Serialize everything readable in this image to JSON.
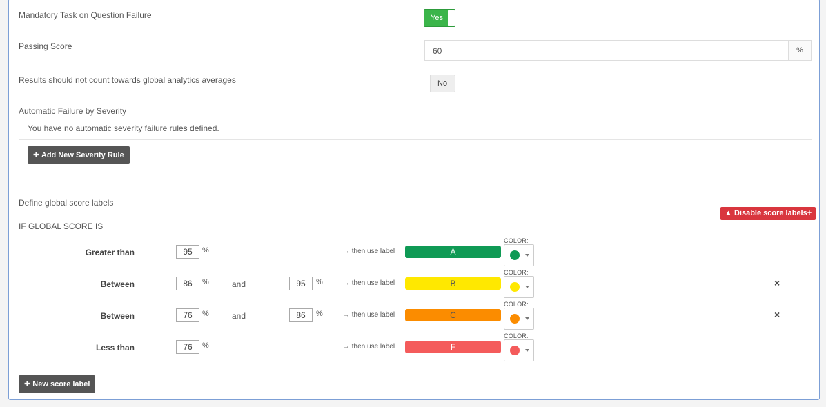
{
  "settings": {
    "mandatory_task": {
      "label": "Mandatory Task on Question Failure",
      "value": "Yes"
    },
    "passing_score": {
      "label": "Passing Score",
      "value": "60",
      "suffix": "%"
    },
    "exclude_analytics": {
      "label": "Results should not count towards global analytics averages",
      "value": "No"
    },
    "severity": {
      "label": "Automatic Failure by Severity",
      "empty_text": "You have no automatic severity failure rules defined.",
      "add_button": "Add New Severity Rule"
    }
  },
  "score_labels": {
    "title": "Define global score labels",
    "condition_heading": "IF GLOBAL SCORE IS",
    "disable_button": "Disable score labels+",
    "then_text": "then use label",
    "color_label": "COLOR:",
    "and_text": "and",
    "pct": "%",
    "rows": [
      {
        "condition": "Greater than",
        "from": "95",
        "to": null,
        "label": "A",
        "color": "#0f9a55",
        "text_color": "#ffffff",
        "removable": false
      },
      {
        "condition": "Between",
        "from": "86",
        "to": "95",
        "label": "B",
        "color": "#ffe800",
        "text_color": "#555555",
        "removable": true
      },
      {
        "condition": "Between",
        "from": "76",
        "to": "86",
        "label": "C",
        "color": "#fb8c00",
        "text_color": "#555555",
        "removable": true
      },
      {
        "condition": "Less than",
        "from": "76",
        "to": null,
        "label": "F",
        "color": "#f45b5b",
        "text_color": "#ffffff",
        "removable": false
      }
    ],
    "remove_symbol": "×",
    "new_button": "New score label"
  }
}
